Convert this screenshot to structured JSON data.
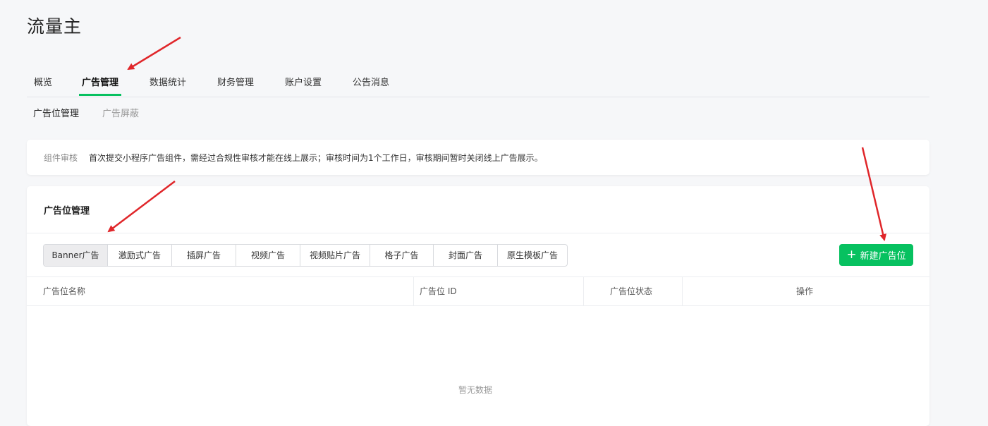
{
  "page_title": "流量主",
  "main_tabs": [
    {
      "label": "概览"
    },
    {
      "label": "广告管理"
    },
    {
      "label": "数据统计"
    },
    {
      "label": "财务管理"
    },
    {
      "label": "账户设置"
    },
    {
      "label": "公告消息"
    }
  ],
  "main_tabs_active": "广告管理",
  "sub_tabs": [
    {
      "label": "广告位管理"
    },
    {
      "label": "广告屏蔽"
    }
  ],
  "notice": {
    "label": "组件审核",
    "text": "首次提交小程序广告组件，需经过合规性审核才能在线上展示；审核时间为1个工作日，审核期间暂时关闭线上广告展示。"
  },
  "card": {
    "title": "广告位管理",
    "ad_types": [
      {
        "label": "Banner广告"
      },
      {
        "label": "激励式广告"
      },
      {
        "label": "插屏广告"
      },
      {
        "label": "视频广告"
      },
      {
        "label": "视频贴片广告"
      },
      {
        "label": "格子广告"
      },
      {
        "label": "封面广告"
      },
      {
        "label": "原生模板广告"
      }
    ],
    "ad_types_active": "Banner广告",
    "new_button_label": "新建广告位",
    "columns": [
      {
        "label": "广告位名称"
      },
      {
        "label": "广告位 ID"
      },
      {
        "label": "广告位状态"
      },
      {
        "label": "操作"
      }
    ],
    "empty_text": "暂无数据"
  },
  "colors": {
    "accent": "#07c160",
    "annotation_arrow": "#e0262a",
    "page_bg": "#f6f7f9"
  }
}
